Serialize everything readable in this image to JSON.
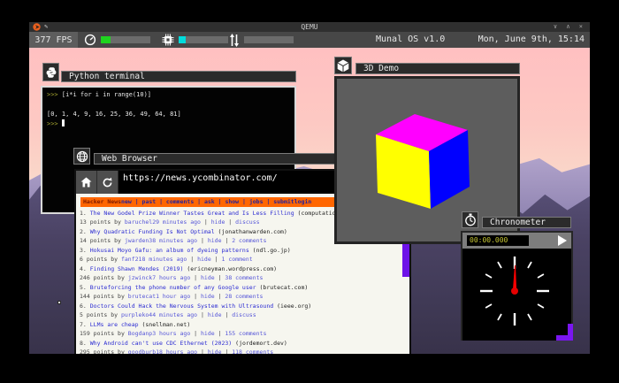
{
  "qemu": {
    "title": "QEMU",
    "window_controls": "∨ ∧ ×",
    "edit_icon_glyph": "✎"
  },
  "statusbar": {
    "fps": "377 FPS",
    "os_name": "Munal OS v1.0",
    "clock": "Mon, June 9th, 15:14",
    "meters": [
      {
        "name": "cpu-load-meter",
        "fill_color": "#1fd41f",
        "fill_pct": 20
      },
      {
        "name": "memory-meter",
        "fill_color": "#00dcdc",
        "fill_pct": 14
      },
      {
        "name": "network-meter",
        "fill_color": "",
        "fill_pct": 0
      }
    ]
  },
  "terminal": {
    "title": "Python terminal",
    "lines": [
      {
        "type": "input",
        "prompt": ">>> ",
        "text": "[i*i for i in range(10)]"
      },
      {
        "type": "blank"
      },
      {
        "type": "output",
        "text": "[0, 1, 4, 9, 16, 25, 36, 49, 64, 81]"
      },
      {
        "type": "input",
        "prompt": ">>> ",
        "text": "",
        "cursor": true
      }
    ]
  },
  "browser": {
    "title": "Web Browser",
    "url": "https://news.ycombinator.com/"
  },
  "hn": {
    "logo": "Hacker News",
    "nav": "new | past | comments | ask | show | jobs | submit",
    "login": "login",
    "stories": [
      {
        "rank": "1.",
        "title": "The New Godel Prize Winner Tastes Great and Is Less Filling",
        "domain": "(computational",
        "meta": [
          {
            "t": "13 points by "
          },
          {
            "t": "baruchel",
            "link": true
          },
          {
            "t": "29 minutes ago",
            "link": true
          },
          {
            "t": " | "
          },
          {
            "t": "hide",
            "link": true
          },
          {
            "t": " | "
          },
          {
            "t": "discuss",
            "link": true
          }
        ]
      },
      {
        "rank": "2.",
        "title": "Why Quadratic Funding Is Not Optimal",
        "domain": "(jonathanwarden.com)",
        "meta": [
          {
            "t": "14 points by "
          },
          {
            "t": "jwarden",
            "link": true
          },
          {
            "t": "38 minutes ago",
            "link": true
          },
          {
            "t": " | "
          },
          {
            "t": "hide",
            "link": true
          },
          {
            "t": " | "
          },
          {
            "t": "2 comments",
            "link": true
          }
        ]
      },
      {
        "rank": "3.",
        "title": "Hokusai Moyo Gafu: an album of dyeing patterns",
        "domain": "(ndl.go.jp)",
        "meta": [
          {
            "t": "6 points by "
          },
          {
            "t": "fanf2",
            "link": true
          },
          {
            "t": "18 minutes ago",
            "link": true
          },
          {
            "t": " | "
          },
          {
            "t": "hide",
            "link": true
          },
          {
            "t": " | "
          },
          {
            "t": "1 comment",
            "link": true
          }
        ]
      },
      {
        "rank": "4.",
        "title": "Finding Shawn Mendes (2019)",
        "domain": "(ericneyman.wordpress.com)",
        "meta": [
          {
            "t": "246 points by "
          },
          {
            "t": "jzwinck",
            "link": true
          },
          {
            "t": "7 hours ago",
            "link": true
          },
          {
            "t": " | "
          },
          {
            "t": "hide",
            "link": true
          },
          {
            "t": " | "
          },
          {
            "t": "38 comments",
            "link": true
          }
        ]
      },
      {
        "rank": "5.",
        "title": "Bruteforcing the phone number of any Google user",
        "domain": "(brutecat.com)",
        "meta": [
          {
            "t": "144 points by "
          },
          {
            "t": "brutecat",
            "link": true
          },
          {
            "t": "1 hour ago",
            "link": true
          },
          {
            "t": " | "
          },
          {
            "t": "hide",
            "link": true
          },
          {
            "t": " | "
          },
          {
            "t": "28 comments",
            "link": true
          }
        ]
      },
      {
        "rank": "6.",
        "title": "Doctors Could Hack the Nervous System with Ultrasound",
        "domain": "(ieee.org)",
        "meta": [
          {
            "t": "5 points by "
          },
          {
            "t": "purpleko4",
            "link": true
          },
          {
            "t": "4 minutes ago",
            "link": true
          },
          {
            "t": " | "
          },
          {
            "t": "hide",
            "link": true
          },
          {
            "t": " | "
          },
          {
            "t": "discuss",
            "link": true
          }
        ]
      },
      {
        "rank": "7.",
        "title": "LLMs are cheap",
        "domain": "(snellman.net)",
        "meta": [
          {
            "t": "159 points by "
          },
          {
            "t": "Bogdanp",
            "link": true
          },
          {
            "t": "3 hours ago",
            "link": true
          },
          {
            "t": " | "
          },
          {
            "t": "hide",
            "link": true
          },
          {
            "t": " | "
          },
          {
            "t": "155 comments",
            "link": true
          }
        ]
      },
      {
        "rank": "8.",
        "title": "Why Android can't use CDC Ethernet (2023)",
        "domain": "(jordemort.dev)",
        "meta": [
          {
            "t": "295 points by "
          },
          {
            "t": "goodburb",
            "link": true
          },
          {
            "t": "18 hours ago",
            "link": true
          },
          {
            "t": " | "
          },
          {
            "t": "hide",
            "link": true
          },
          {
            "t": " | "
          },
          {
            "t": "118 comments",
            "link": true
          }
        ]
      }
    ]
  },
  "demo3d": {
    "title": "3D Demo",
    "cube": {
      "top": "#ff00ff",
      "left": "#ffff00",
      "right": "#0000ff"
    }
  },
  "chronometer": {
    "title": "Chronometer",
    "display": "00:00.000"
  }
}
